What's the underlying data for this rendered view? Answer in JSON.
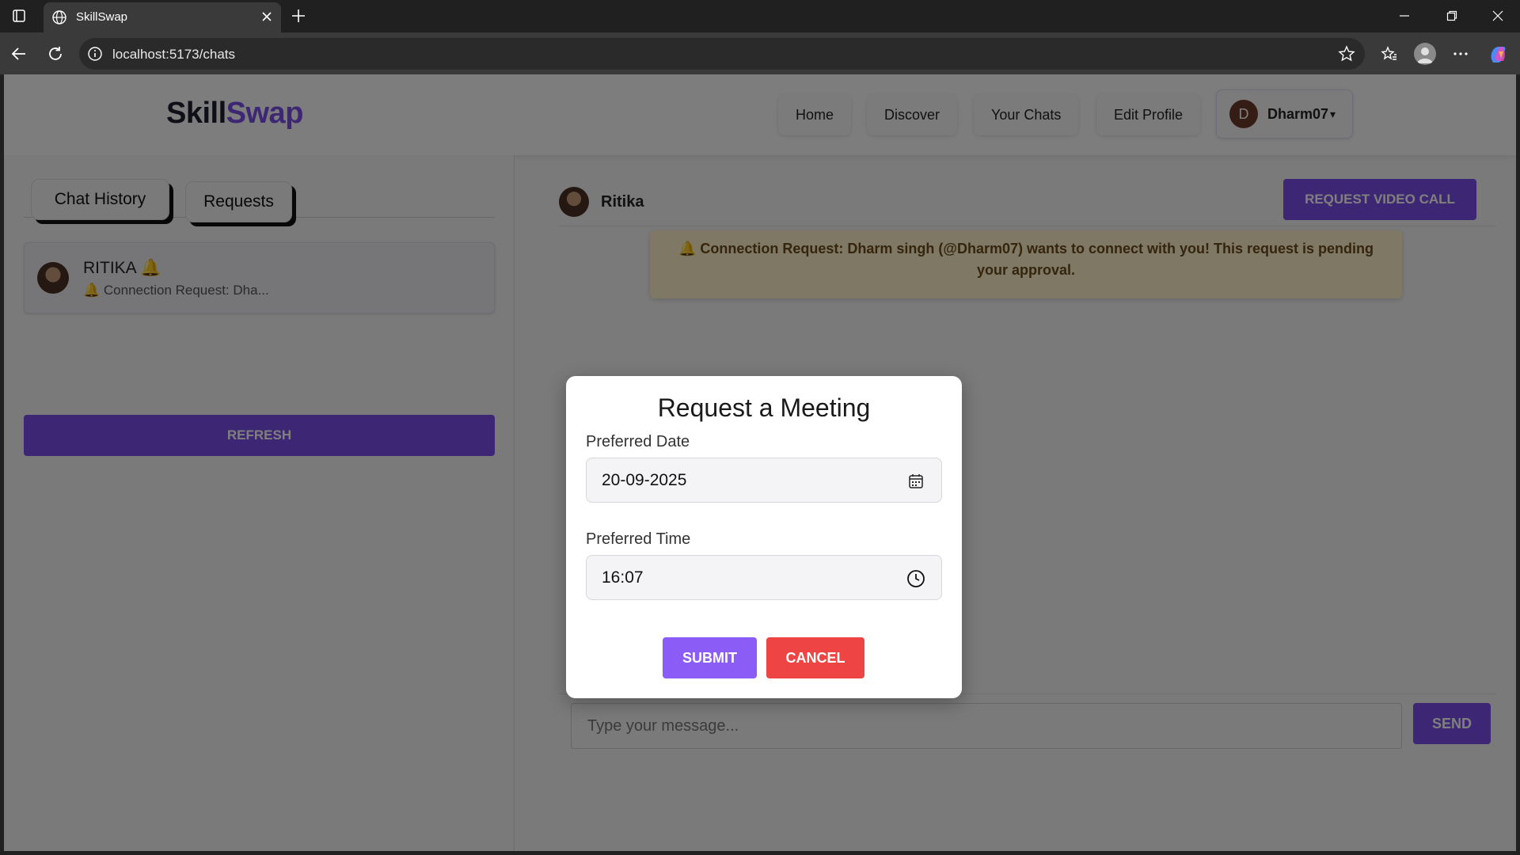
{
  "browser": {
    "tab_title": "SkillSwap",
    "url": "localhost:5173/chats"
  },
  "navbar": {
    "logo_part1": "Skill",
    "logo_part2": "Swap",
    "links": [
      "Home",
      "Discover",
      "Your Chats",
      "Edit Profile"
    ],
    "user": {
      "initial": "D",
      "name": "Dharm07",
      "caret": "▾"
    }
  },
  "sidebar": {
    "tabs": [
      "Chat History",
      "Requests"
    ],
    "chats": [
      {
        "name": "RITIKA 🔔",
        "preview": "🔔 Connection Request: Dha..."
      }
    ],
    "refresh_label": "REFRESH"
  },
  "chat": {
    "contact_name": "Ritika",
    "video_call_label": "REQUEST VIDEO CALL",
    "notice": "🔔 Connection Request: Dharm singh (@Dharm07) wants to connect with you! This request is pending your approval.",
    "message_placeholder": "Type your message...",
    "send_label": "SEND"
  },
  "modal": {
    "title": "Request a Meeting",
    "date_label": "Preferred Date",
    "date_value": "20-09-2025",
    "time_label": "Preferred Time",
    "time_value": "16:07",
    "submit_label": "SUBMIT",
    "cancel_label": "CANCEL"
  },
  "colors": {
    "accent": "#7b4ee8",
    "submit": "#8b5cf6",
    "cancel": "#ef4444",
    "notice_bg": "#fdf0c8"
  }
}
